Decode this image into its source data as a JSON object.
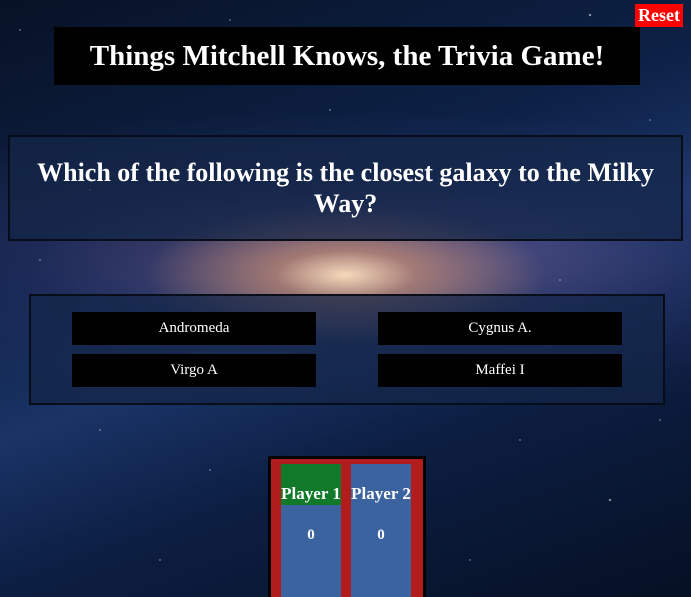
{
  "reset_label": "Reset",
  "title": "Things Mitchell Knows, the Trivia Game!",
  "question": "Which of the following is the closest galaxy to the Milky Way?",
  "answers": [
    "Andromeda",
    "Cygnus A.",
    "Virgo A",
    "Maffei I"
  ],
  "players": [
    {
      "label": "Player 1",
      "score": "0",
      "active": true
    },
    {
      "label": "Player 2",
      "score": "0",
      "active": false
    }
  ],
  "colors": {
    "reset": "#ff0000",
    "active_player": "#117a2a",
    "player_card": "#3a63a0",
    "scoreboard_frame": "#b11c1c"
  }
}
